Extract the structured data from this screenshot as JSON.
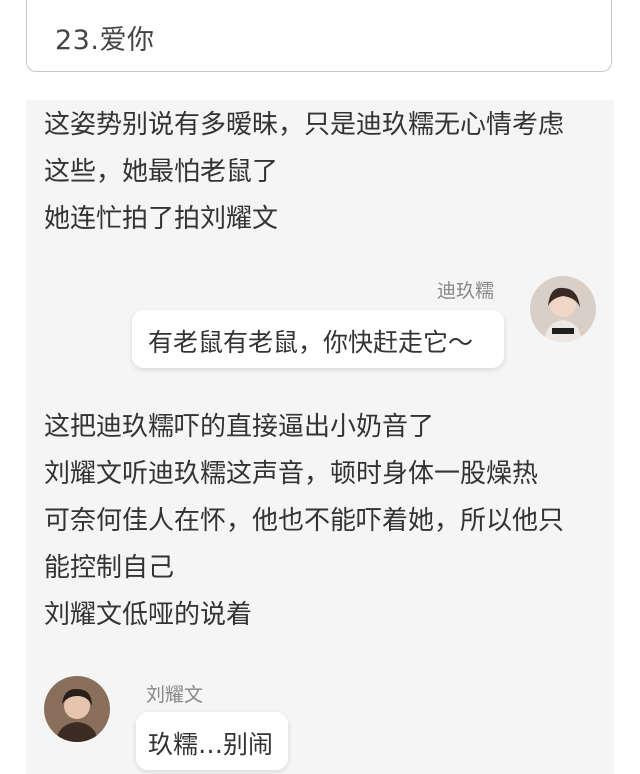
{
  "chapter": {
    "title": "23.爱你"
  },
  "paragraphs": [
    {
      "lines": [
        "这姿势别说有多暧昧，只是迪玖糯无心情考虑",
        "这些，她最怕老鼠了",
        "她连忙拍了拍刘耀文"
      ]
    },
    {
      "lines": [
        "这把迪玖糯吓的直接逼出小奶音了",
        "刘耀文听迪玖糯这声音，顿时身体一股燥热",
        "可奈何佳人在怀，他也不能吓着她，所以他只",
        "能控制自己",
        "刘耀文低哑的说着"
      ]
    }
  ],
  "messages": [
    {
      "side": "right",
      "name": "迪玖糯",
      "text": "有老鼠有老鼠，你快赶走它～",
      "avatar": "female-avatar"
    },
    {
      "side": "left",
      "name": "刘耀文",
      "text": "玖糯…别闹",
      "avatar": "male-avatar"
    }
  ],
  "colors": {
    "background": "#f5f5f5",
    "bubble": "#ffffff",
    "text": "#333333",
    "name": "#888888"
  }
}
